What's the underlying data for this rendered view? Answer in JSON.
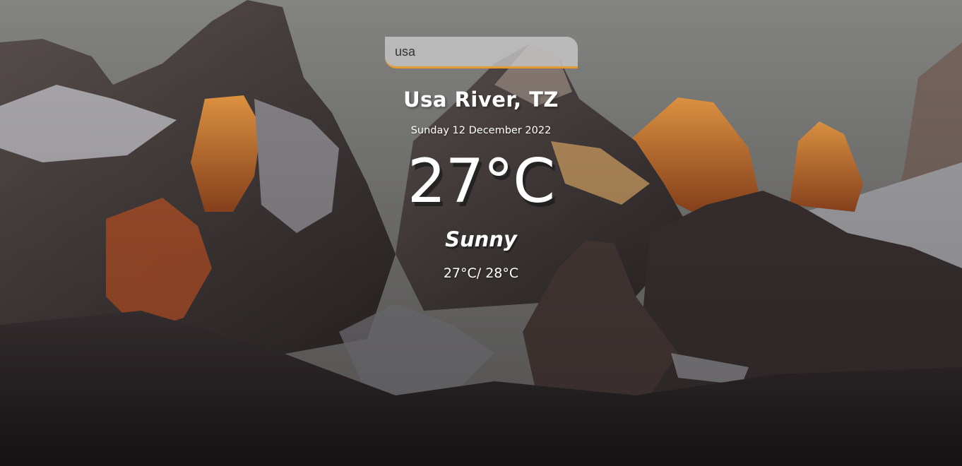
{
  "search": {
    "value": "usa",
    "placeholder": ""
  },
  "weather": {
    "location": "Usa River, TZ",
    "date": "Sunday 12 December 2022",
    "temperature": "27°C",
    "condition": "Sunny",
    "range": "27°C/ 28°C"
  },
  "colors": {
    "search_underline": "#e49a2f",
    "text": "#ffffff"
  }
}
